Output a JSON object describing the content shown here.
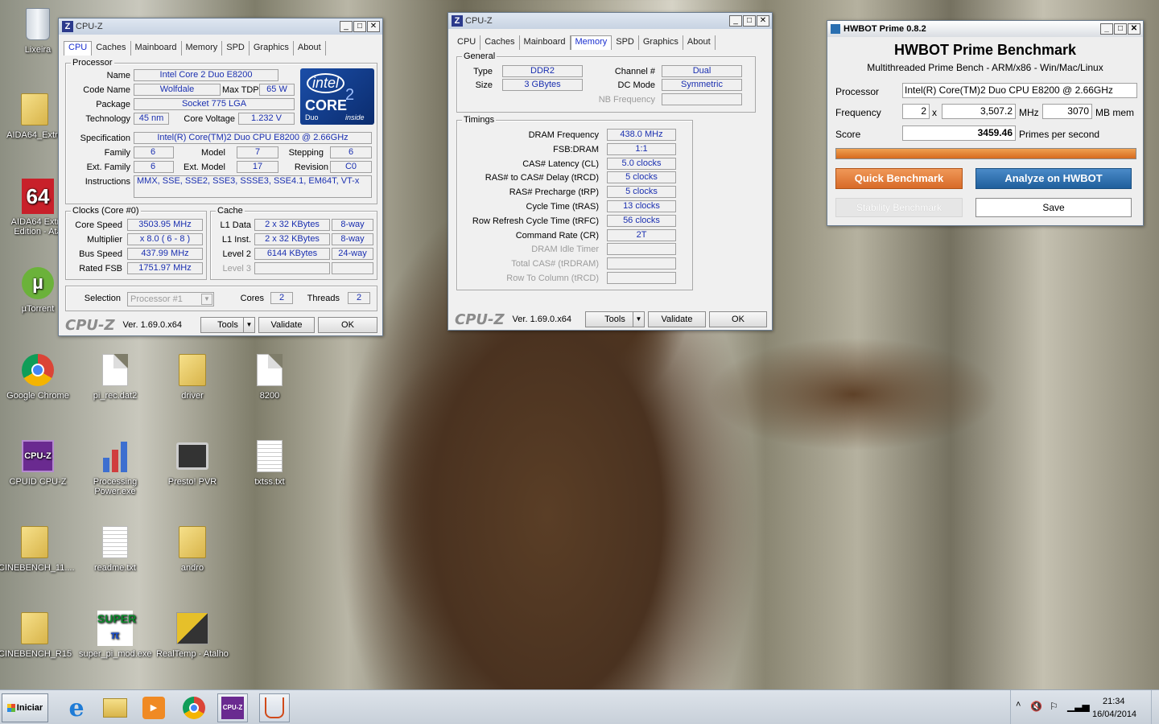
{
  "desktop_icons": [
    {
      "label": "Lixeira"
    },
    {
      "label": "AIDA64_Extre"
    },
    {
      "label": "AIDA64 Extre Edition - Ata"
    },
    {
      "label": "µTorrent"
    },
    {
      "label": "Google Chrome"
    },
    {
      "label": "pi_rec.dat2"
    },
    {
      "label": "driver"
    },
    {
      "label": "8200"
    },
    {
      "label": "CPUID CPU-Z"
    },
    {
      "label": "Processing Power.exe"
    },
    {
      "label": "Presto! PVR"
    },
    {
      "label": "txtss.txt"
    },
    {
      "label": "CINEBENCH_11...."
    },
    {
      "label": "readme.txt"
    },
    {
      "label": "andro"
    },
    {
      "label": "CINEBENCH_R15"
    },
    {
      "label": "super_pi_mod.exe"
    },
    {
      "label": "RealTemp - Atalho"
    }
  ],
  "cpuz1": {
    "title": "CPU-Z",
    "tabs": [
      "CPU",
      "Caches",
      "Mainboard",
      "Memory",
      "SPD",
      "Graphics",
      "About"
    ],
    "processor": {
      "group": "Processor",
      "name_label": "Name",
      "name": "Intel Core 2 Duo E8200",
      "codename_label": "Code Name",
      "codename": "Wolfdale",
      "maxtdp_label": "Max TDP",
      "maxtdp": "65 W",
      "package_label": "Package",
      "package": "Socket 775 LGA",
      "tech_label": "Technology",
      "tech": "45 nm",
      "voltage_label": "Core Voltage",
      "voltage": "1.232 V",
      "spec_label": "Specification",
      "spec": "Intel(R) Core(TM)2 Duo CPU     E8200  @ 2.66GHz",
      "family_label": "Family",
      "family": "6",
      "model_label": "Model",
      "model": "7",
      "stepping_label": "Stepping",
      "stepping": "6",
      "extfamily_label": "Ext. Family",
      "extfamily": "6",
      "extmodel_label": "Ext. Model",
      "extmodel": "17",
      "revision_label": "Revision",
      "revision": "C0",
      "instr_label": "Instructions",
      "instr": "MMX, SSE, SSE2, SSE3, SSSE3, SSE4.1, EM64T, VT-x"
    },
    "logo": {
      "brand": "intel",
      "line": "CORE",
      "num": "2",
      "sub": "Duo",
      "inside": "inside"
    },
    "clocks": {
      "group": "Clocks (Core #0)",
      "speed_label": "Core Speed",
      "speed": "3503.95 MHz",
      "mult_label": "Multiplier",
      "mult": "x 8.0 ( 6 - 8 )",
      "bus_label": "Bus Speed",
      "bus": "437.99 MHz",
      "fsb_label": "Rated FSB",
      "fsb": "1751.97 MHz"
    },
    "cache": {
      "group": "Cache",
      "l1d_label": "L1 Data",
      "l1d": "2 x 32 KBytes",
      "l1d_way": "8-way",
      "l1i_label": "L1 Inst.",
      "l1i": "2 x 32 KBytes",
      "l1i_way": "8-way",
      "l2_label": "Level 2",
      "l2": "6144 KBytes",
      "l2_way": "24-way",
      "l3_label": "Level 3"
    },
    "sel_label": "Selection",
    "sel": "Processor #1",
    "cores_label": "Cores",
    "cores": "2",
    "threads_label": "Threads",
    "threads": "2",
    "footer": {
      "logo": "CPU-Z",
      "ver": "Ver. 1.69.0.x64",
      "tools": "Tools",
      "validate": "Validate",
      "ok": "OK"
    }
  },
  "cpuz2": {
    "title": "CPU-Z",
    "tabs": [
      "CPU",
      "Caches",
      "Mainboard",
      "Memory",
      "SPD",
      "Graphics",
      "About"
    ],
    "general": {
      "group": "General",
      "type_label": "Type",
      "type": "DDR2",
      "channel_label": "Channel #",
      "channel": "Dual",
      "size_label": "Size",
      "size": "3 GBytes",
      "dcmode_label": "DC Mode",
      "dcmode": "Symmetric",
      "nbfreq_label": "NB Frequency"
    },
    "timings": {
      "group": "Timings",
      "rows": [
        {
          "label": "DRAM Frequency",
          "value": "438.0 MHz",
          "dis": false
        },
        {
          "label": "FSB:DRAM",
          "value": "1:1",
          "dis": false
        },
        {
          "label": "CAS# Latency (CL)",
          "value": "5.0 clocks",
          "dis": false
        },
        {
          "label": "RAS# to CAS# Delay (tRCD)",
          "value": "5 clocks",
          "dis": false
        },
        {
          "label": "RAS# Precharge (tRP)",
          "value": "5 clocks",
          "dis": false
        },
        {
          "label": "Cycle Time (tRAS)",
          "value": "13 clocks",
          "dis": false
        },
        {
          "label": "Row Refresh Cycle Time (tRFC)",
          "value": "56 clocks",
          "dis": false
        },
        {
          "label": "Command Rate (CR)",
          "value": "2T",
          "dis": false
        },
        {
          "label": "DRAM Idle Timer",
          "value": "",
          "dis": true
        },
        {
          "label": "Total CAS# (tRDRAM)",
          "value": "",
          "dis": true
        },
        {
          "label": "Row To Column (tRCD)",
          "value": "",
          "dis": true
        }
      ]
    },
    "footer": {
      "logo": "CPU-Z",
      "ver": "Ver. 1.69.0.x64",
      "tools": "Tools",
      "validate": "Validate",
      "ok": "OK"
    }
  },
  "hwbot": {
    "title": "HWBOT Prime 0.8.2",
    "heading": "HWBOT Prime Benchmark",
    "subheading": "Multithreaded Prime Bench - ARM/x86 - Win/Mac/Linux",
    "proc_label": "Processor",
    "proc": "Intel(R) Core(TM)2 Duo CPU     E8200  @ 2.66GHz",
    "freq_label": "Frequency",
    "cores": "2",
    "x": "x",
    "freq": "3,507.2",
    "mhz": "MHz",
    "mem": "3070",
    "mem_label": "MB mem",
    "score_label": "Score",
    "score": "3459.46",
    "score_unit": "Primes per second",
    "progress": 1.0,
    "quick": "Quick Benchmark",
    "analyze": "Analyze on HWBOT",
    "stability": "Stability Benchmark",
    "save": "Save",
    "colors": {
      "orange": "#e07a30",
      "blue": "#2a6fb0"
    }
  },
  "taskbar": {
    "start": "Iniciar",
    "time": "21:34",
    "date": "16/04/2014"
  }
}
